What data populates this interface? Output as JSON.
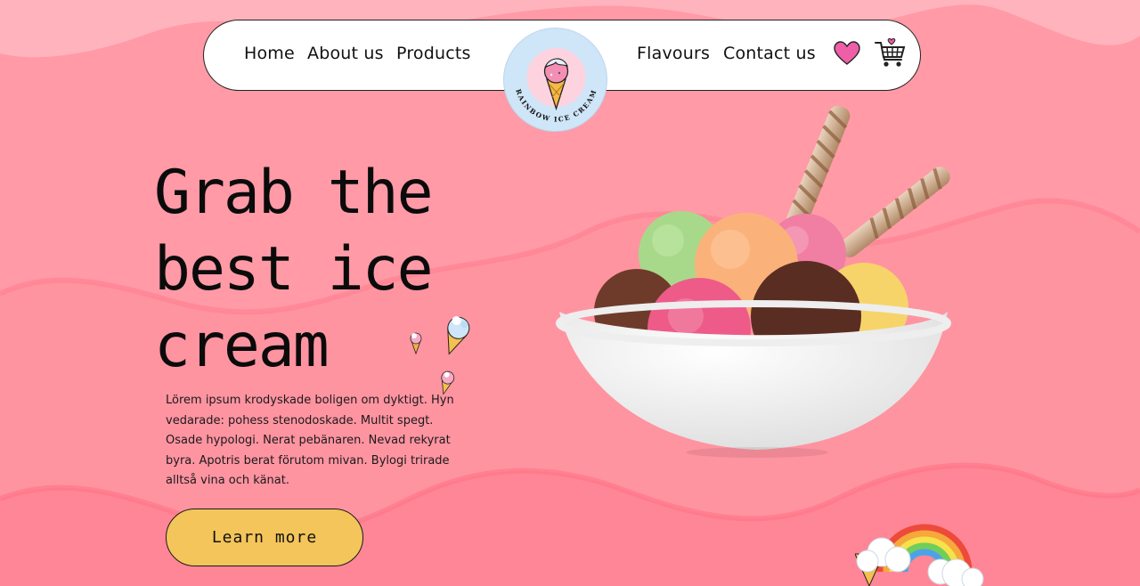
{
  "nav": {
    "links": [
      "Home",
      "About us",
      "Products",
      "Flavours",
      "Contact us"
    ]
  },
  "logo": {
    "text": "RAINBOW ICE CREAM",
    "icon": "ice-cream-cone-icon"
  },
  "icons": {
    "wishlist": "heart-icon",
    "cart": "shopping-cart-icon"
  },
  "hero": {
    "title_lines": [
      "Grab the",
      "best ice",
      "cream"
    ],
    "description": "Lörem ipsum krodyskade boligen om dyktigt. Hyn vedarade: pohess stenodoskade. Multit spegt. Osade hypologi. Nerat pebänaren. Nevad rekyrat byra. Apotris berat förutom mivan. Bylogi trirade alltså vina och känat.",
    "cta": "Learn more"
  },
  "colors": {
    "background": "#ff9aa6",
    "wave_light": "#ffb4bd",
    "wave_dark": "#ff8a98",
    "button": "#f4c55a",
    "logo_bg": "#cfe5f8",
    "heart": "#ee5fa7"
  }
}
